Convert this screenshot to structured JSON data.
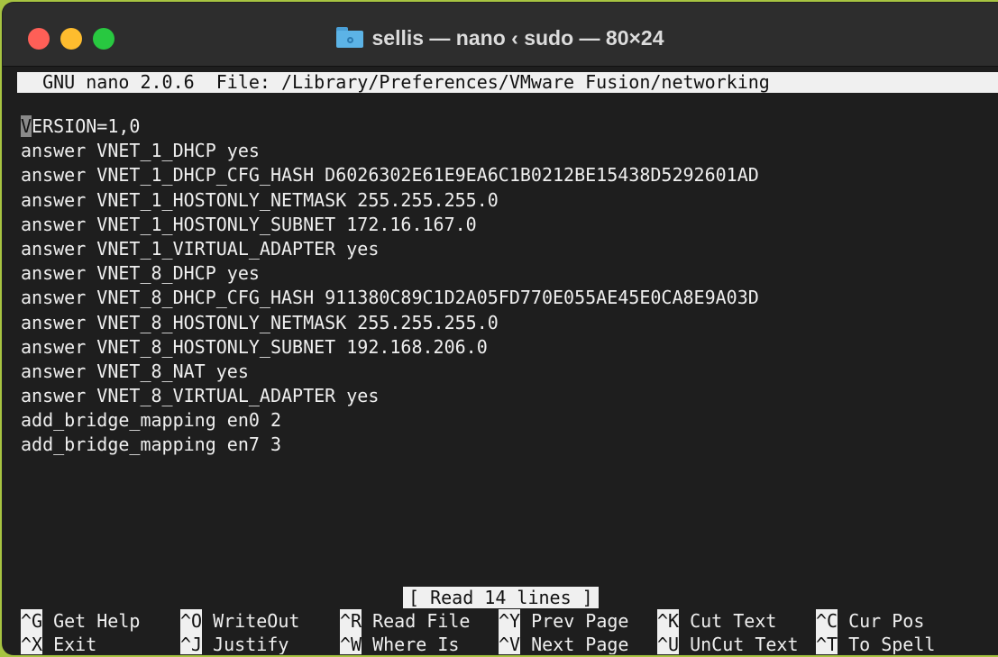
{
  "window": {
    "title": "sellis — nano ‹ sudo — 80×24",
    "folder_icon": "folder-icon"
  },
  "nano": {
    "header": "  GNU nano 2.0.6  File: /Library/Preferences/VMware Fusion/networking",
    "cursor_char": "V",
    "lines": [
      "ERSION=1,0",
      "answer VNET_1_DHCP yes",
      "answer VNET_1_DHCP_CFG_HASH D6026302E61E9EA6C1B0212BE15438D5292601AD",
      "answer VNET_1_HOSTONLY_NETMASK 255.255.255.0",
      "answer VNET_1_HOSTONLY_SUBNET 172.16.167.0",
      "answer VNET_1_VIRTUAL_ADAPTER yes",
      "answer VNET_8_DHCP yes",
      "answer VNET_8_DHCP_CFG_HASH 911380C89C1D2A05FD770E055AE45E0CA8E9A03D",
      "answer VNET_8_HOSTONLY_NETMASK 255.255.255.0",
      "answer VNET_8_HOSTONLY_SUBNET 192.168.206.0",
      "answer VNET_8_NAT yes",
      "answer VNET_8_VIRTUAL_ADAPTER yes",
      "add_bridge_mapping en0 2",
      "add_bridge_mapping en7 3"
    ],
    "status": "[ Read 14 lines ]",
    "shortcuts": [
      [
        {
          "key": "^G",
          "label": "Get Help"
        },
        {
          "key": "^O",
          "label": "WriteOut"
        },
        {
          "key": "^R",
          "label": "Read File"
        },
        {
          "key": "^Y",
          "label": "Prev Page"
        },
        {
          "key": "^K",
          "label": "Cut Text"
        },
        {
          "key": "^C",
          "label": "Cur Pos"
        }
      ],
      [
        {
          "key": "^X",
          "label": "Exit"
        },
        {
          "key": "^J",
          "label": "Justify"
        },
        {
          "key": "^W",
          "label": "Where Is"
        },
        {
          "key": "^V",
          "label": "Next Page"
        },
        {
          "key": "^U",
          "label": "UnCut Text"
        },
        {
          "key": "^T",
          "label": "To Spell"
        }
      ]
    ]
  }
}
